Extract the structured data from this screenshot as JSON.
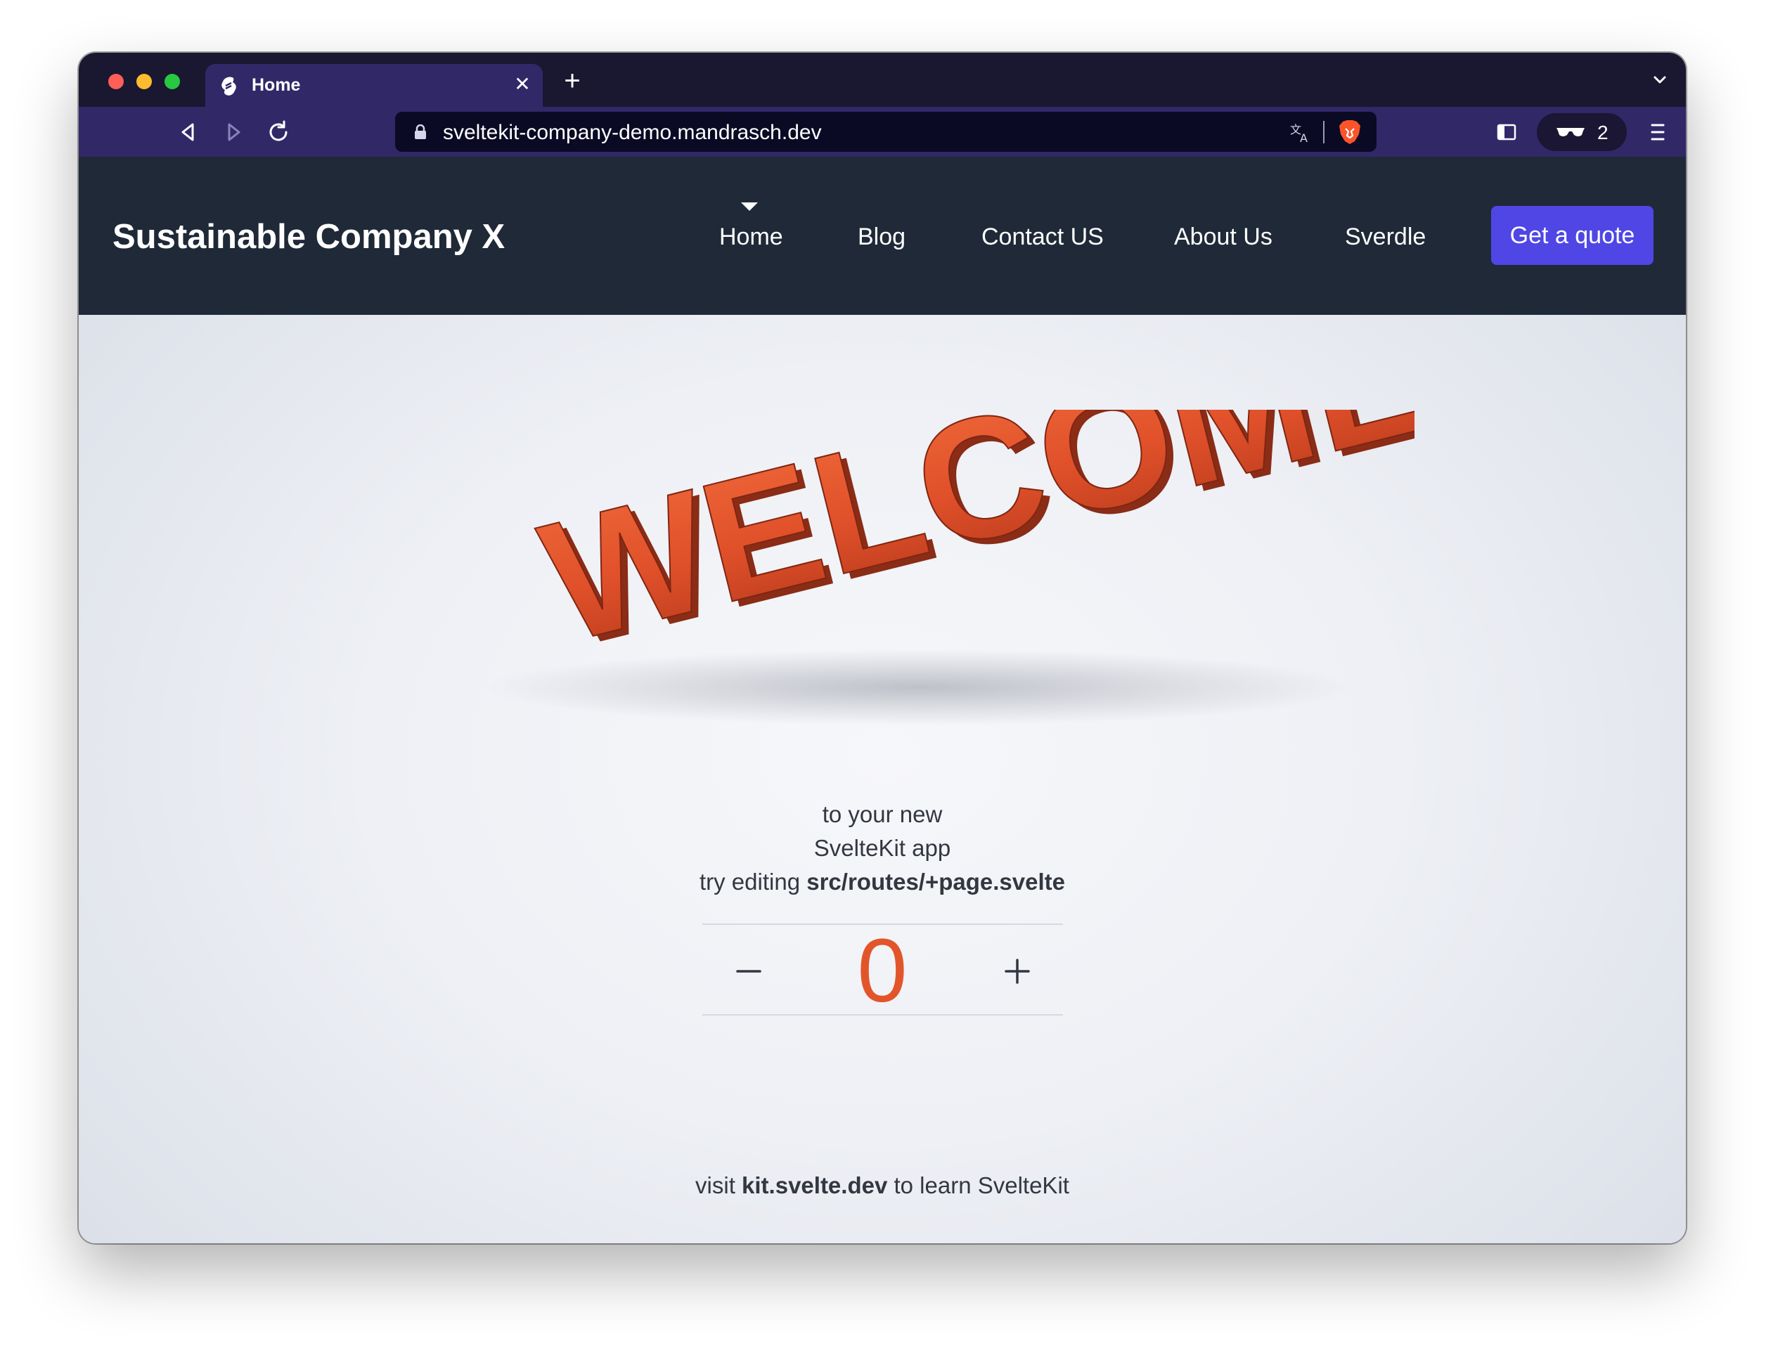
{
  "browser": {
    "tab_title": "Home",
    "url": "sveltekit-company-demo.mandrasch.dev",
    "shields_count": "2",
    "icons": {
      "tab_favicon": "svelte-icon",
      "tab_close": "close-icon",
      "new_tab": "plus-icon",
      "back": "back-arrow-icon",
      "forward": "forward-arrow-icon",
      "reload": "reload-icon",
      "bookmark": "bookmark-icon",
      "lock": "lock-icon",
      "translate": "translate-icon",
      "brave": "brave-lion-icon",
      "sidebar": "sidebar-icon",
      "shields": "glasses-icon",
      "menu": "hamburger-menu-icon"
    }
  },
  "nav": {
    "brand": "Sustainable Company X",
    "links": [
      "Home",
      "Blog",
      "Contact US",
      "About Us",
      "Sverdle"
    ],
    "active": "Home",
    "cta": "Get a quote"
  },
  "hero": {
    "welcome_image_text": "WELCOME",
    "line1": "to your new",
    "line2": "SvelteKit app",
    "line3_prefix": "try editing ",
    "line3_code": "src/routes/+page.svelte"
  },
  "counter": {
    "value": "0",
    "decrement_label": "minus-icon",
    "increment_label": "plus-icon"
  },
  "footer": {
    "prefix": "visit ",
    "link": "kit.svelte.dev",
    "suffix": " to learn SvelteKit"
  },
  "colors": {
    "nav_bg": "#1f2937",
    "cta_bg": "#4f46e5",
    "accent_orange": "#e2552a",
    "toolbar_bg": "#312868",
    "tabstrip_bg": "#1a1731"
  }
}
